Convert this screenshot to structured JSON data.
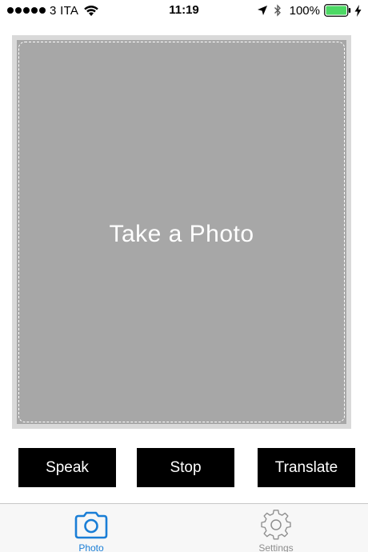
{
  "status_bar": {
    "carrier": "3 ITA",
    "time": "11:19",
    "battery_percent": "100%",
    "icons": [
      "signal-dots",
      "wifi-icon",
      "location-icon",
      "bluetooth-icon",
      "battery-icon",
      "charging-bolt-icon"
    ]
  },
  "photo": {
    "label": "Take a Photo"
  },
  "actions": {
    "speak": "Speak",
    "stop": "Stop",
    "translate": "Translate"
  },
  "tabs": [
    {
      "label": "Photo",
      "icon": "camera-icon",
      "selected": true
    },
    {
      "label": "Settings",
      "icon": "gear-icon",
      "selected": false
    }
  ],
  "colors": {
    "accent": "#1a7ed6",
    "placeholder": "#a7a7a7",
    "button": "#000000",
    "battery": "#4cd964",
    "tab_inactive": "#8e8e8e"
  }
}
